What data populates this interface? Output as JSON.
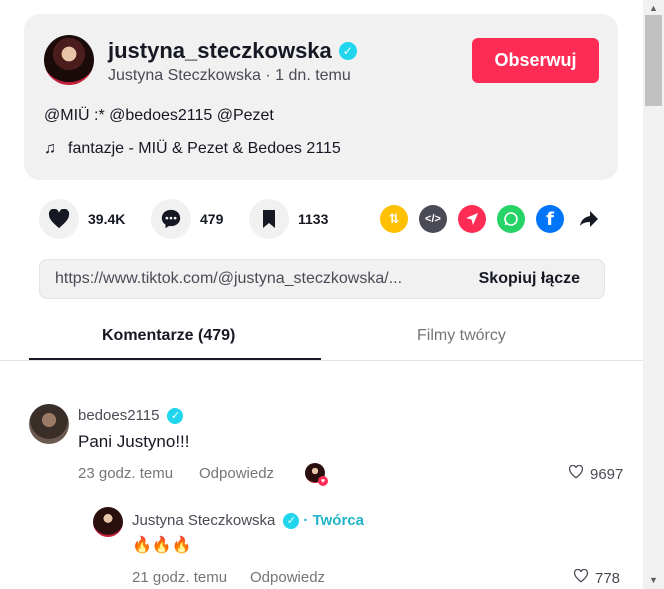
{
  "post": {
    "username": "justyna_steczkowska",
    "subline": "Justyna Steczkowska · 1 dn. temu",
    "follow_label": "Obserwuj",
    "description": "@MIÜ :* @bedoes2115 @Pezet",
    "music": "fantazje - MIÜ & Pezet & Bedoes 2115"
  },
  "actions": {
    "likes": "39.4K",
    "comments": "479",
    "saves": "1133"
  },
  "share": {
    "url": "https://www.tiktok.com/@justyna_steczkowska/...",
    "copy_label": "Skopiuj łącze"
  },
  "tabs": {
    "comments": "Komentarze (479)",
    "creator_videos": "Filmy twórcy"
  },
  "comments": [
    {
      "user": "bedoes2115",
      "text": "Pani Justyno!!!",
      "time": "23 godz. temu",
      "reply_label": "Odpowiedz",
      "likes": "9697"
    },
    {
      "user": "Justyna Steczkowska",
      "creator_badge": "· Twórca",
      "text": "🔥🔥🔥",
      "time": "21 godz. temu",
      "reply_label": "Odpowiedz",
      "likes": "778"
    }
  ],
  "colors": {
    "accent": "#fe2c55",
    "verified": "#20d5ec"
  }
}
